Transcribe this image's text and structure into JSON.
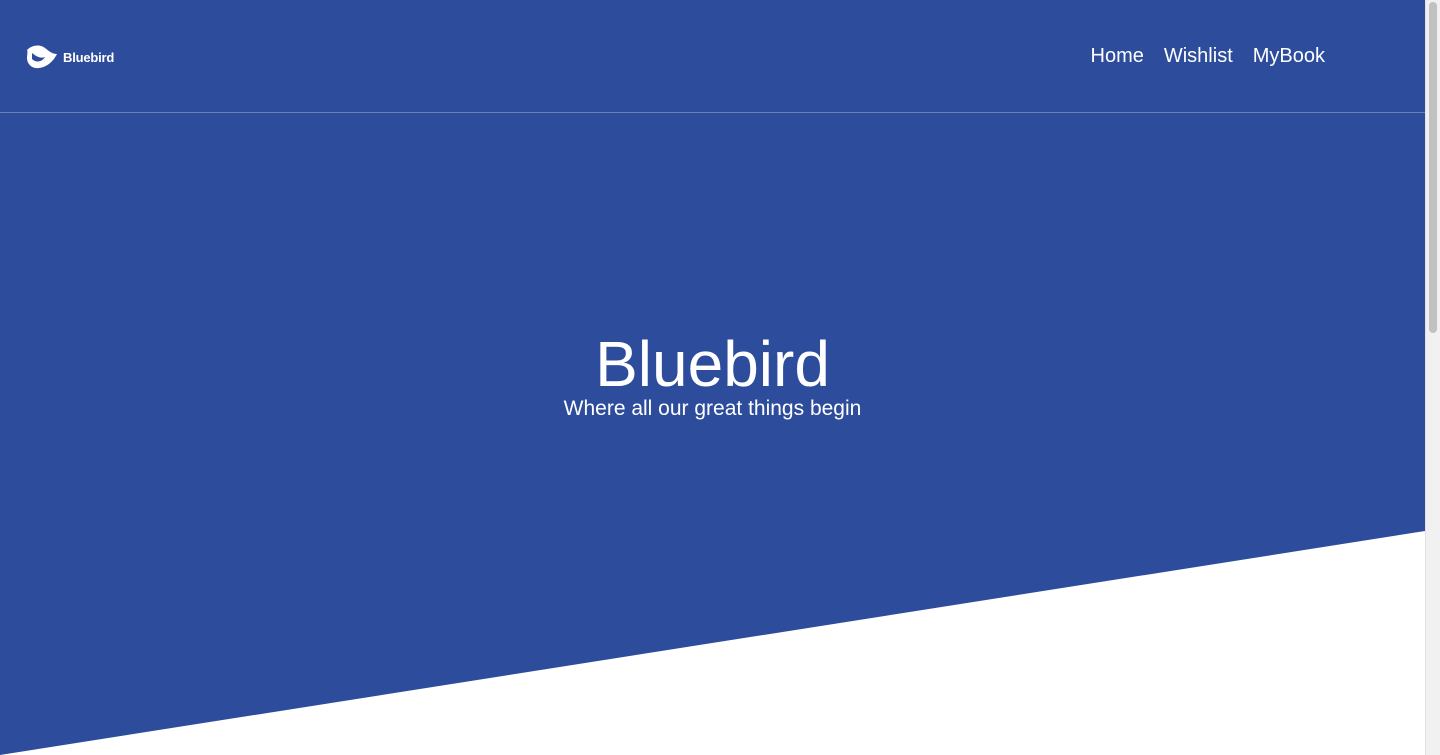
{
  "brand": {
    "name": "Bluebird",
    "logo_icon": "bluebird-logo-icon"
  },
  "nav": {
    "items": [
      {
        "label": "Home"
      },
      {
        "label": "Wishlist"
      },
      {
        "label": "MyBook"
      }
    ]
  },
  "hero": {
    "title": "Bluebird",
    "subtitle": "Where all our great things begin"
  },
  "colors": {
    "primary": "#2d4d9c",
    "background": "#ffffff",
    "text_on_primary": "#ffffff"
  }
}
